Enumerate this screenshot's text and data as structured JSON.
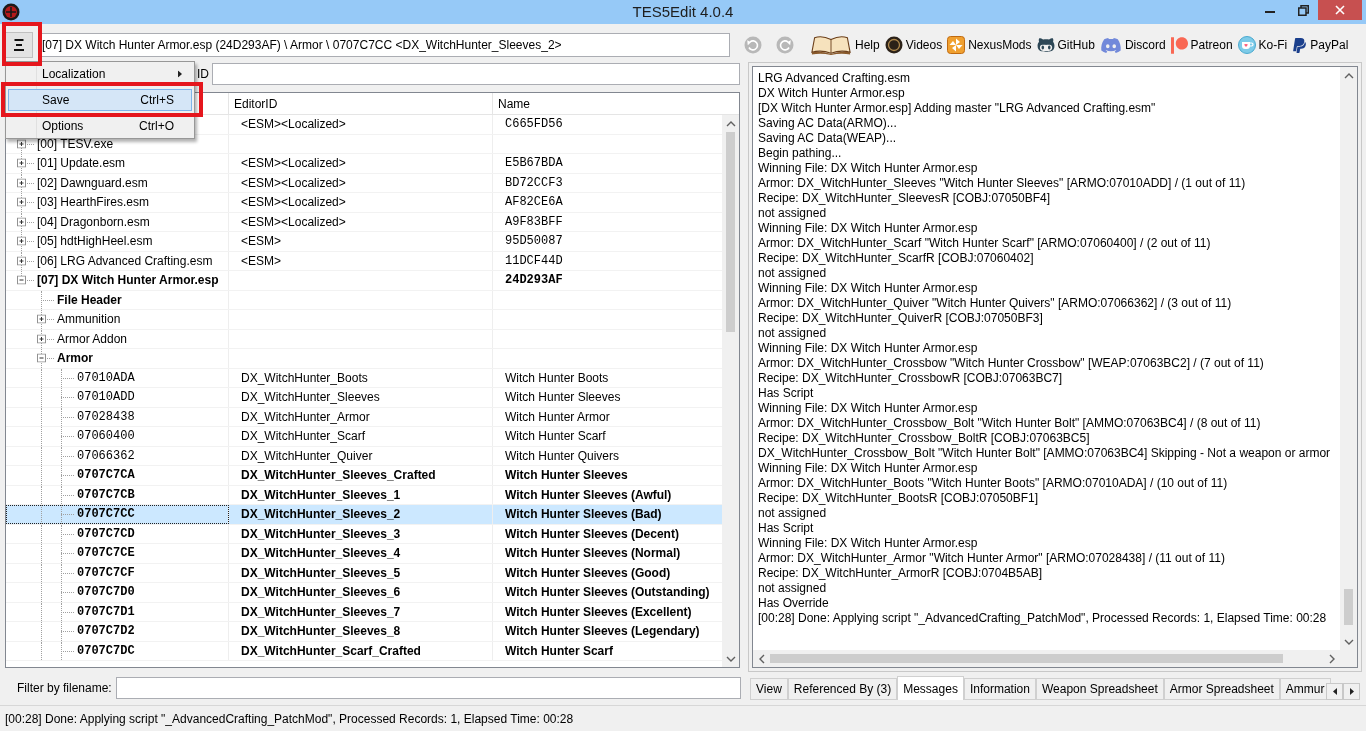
{
  "window": {
    "title": "TES5Edit 4.0.4"
  },
  "menu_button": {
    "highlighted": true
  },
  "path_field": {
    "value": "[07] DX Witch Hunter Armor.esp (24D293AF) \\ Armor \\ 0707C7CC <DX_WitchHunter_Sleeves_2>"
  },
  "navigation": [
    {
      "kind": "back",
      "disabled": true
    },
    {
      "kind": "forward",
      "disabled": true
    }
  ],
  "links": [
    {
      "kind": "book",
      "label": "Help"
    },
    {
      "kind": "disc",
      "label": "Videos"
    },
    {
      "kind": "nexus",
      "label": "NexusMods"
    },
    {
      "kind": "github",
      "label": "GitHub"
    },
    {
      "kind": "discord",
      "label": "Discord"
    },
    {
      "kind": "patreon",
      "label": "Patreon"
    },
    {
      "kind": "kofi",
      "label": "Ko-Fi"
    },
    {
      "kind": "paypal",
      "label": "PayPal"
    }
  ],
  "main_menu": {
    "items": [
      {
        "label": "Localization",
        "submenu": true,
        "selected": false,
        "highlighted": false
      },
      {
        "label": "Save",
        "shortcut": "Ctrl+S",
        "selected": true,
        "highlighted": true
      },
      {
        "label": "Options",
        "shortcut": "Ctrl+O",
        "selected": false,
        "highlighted": false
      }
    ]
  },
  "id_search": {
    "label": "ID"
  },
  "tree": {
    "column_headers": {
      "column_2": "EditorID",
      "column_3": "Name"
    },
    "rows": [
      {
        "kind": "file",
        "editor_id": "<ESM><Localized>",
        "name": "C665FD56",
        "bold": false,
        "selected": false
      },
      {
        "kind": "file",
        "label": "[00] TESV.exe",
        "expanded": false,
        "bold": false,
        "selected": false
      },
      {
        "kind": "file",
        "label": "[01] Update.esm",
        "editor_id": "<ESM><Localized>",
        "name": "E5B67BDA",
        "expanded": false,
        "bold": false,
        "selected": false
      },
      {
        "kind": "file",
        "label": "[02] Dawnguard.esm",
        "editor_id": "<ESM><Localized>",
        "name": "BD72CCF3",
        "expanded": false,
        "bold": false,
        "selected": false
      },
      {
        "kind": "file",
        "label": "[03] HearthFires.esm",
        "editor_id": "<ESM><Localized>",
        "name": "AF82CE6A",
        "expanded": false,
        "bold": false,
        "selected": false
      },
      {
        "kind": "file",
        "label": "[04] Dragonborn.esm",
        "editor_id": "<ESM><Localized>",
        "name": "A9F83BFF",
        "expanded": false,
        "bold": false,
        "selected": false
      },
      {
        "kind": "file",
        "label": "[05] hdtHighHeel.esm",
        "editor_id": "<ESM>",
        "name": "95D50087",
        "expanded": false,
        "bold": false,
        "selected": false
      },
      {
        "kind": "file",
        "label": "[06] LRG Advanced Crafting.esm",
        "editor_id": "<ESM>",
        "name": "11DCF44D",
        "expanded": false,
        "bold": false,
        "selected": false
      },
      {
        "kind": "file",
        "label": "[07] DX Witch Hunter Armor.esp",
        "name": "24D293AF",
        "expanded": true,
        "bold": true,
        "selected": false,
        "children": [
          {
            "kind": "group",
            "label": "File Header",
            "bold": true,
            "selected": false
          },
          {
            "kind": "group",
            "label": "Ammunition",
            "expanded": false,
            "bold": false,
            "selected": false
          },
          {
            "kind": "group",
            "label": "Armor Addon",
            "expanded": false,
            "bold": false,
            "selected": false
          },
          {
            "kind": "group",
            "label": "Armor",
            "expanded": true,
            "bold": true,
            "selected": false,
            "children": [
              {
                "kind": "record",
                "label": "07010ADA",
                "editor_id": "DX_WitchHunter_Boots",
                "name": "Witch Hunter Boots",
                "bold": false,
                "selected": false
              },
              {
                "kind": "record",
                "label": "07010ADD",
                "editor_id": "DX_WitchHunter_Sleeves",
                "name": "Witch Hunter Sleeves",
                "bold": false,
                "selected": false
              },
              {
                "kind": "record",
                "label": "07028438",
                "editor_id": "DX_WitchHunter_Armor",
                "name": "Witch Hunter Armor",
                "bold": false,
                "selected": false
              },
              {
                "kind": "record",
                "label": "07060400",
                "editor_id": "DX_WitchHunter_Scarf",
                "name": "Witch Hunter Scarf",
                "bold": false,
                "selected": false
              },
              {
                "kind": "record",
                "label": "07066362",
                "editor_id": "DX_WitchHunter_Quiver",
                "name": "Witch Hunter Quivers",
                "bold": false,
                "selected": false
              },
              {
                "kind": "record",
                "label": "0707C7CA",
                "editor_id": "DX_WitchHunter_Sleeves_Crafted",
                "name": "Witch Hunter Sleeves",
                "bold": true,
                "selected": false
              },
              {
                "kind": "record",
                "label": "0707C7CB",
                "editor_id": "DX_WitchHunter_Sleeves_1",
                "name": "Witch Hunter Sleeves (Awful)",
                "bold": true,
                "selected": false
              },
              {
                "kind": "record",
                "label": "0707C7CC",
                "editor_id": "DX_WitchHunter_Sleeves_2",
                "name": "Witch Hunter Sleeves (Bad)",
                "bold": true,
                "selected": true
              },
              {
                "kind": "record",
                "label": "0707C7CD",
                "editor_id": "DX_WitchHunter_Sleeves_3",
                "name": "Witch Hunter Sleeves (Decent)",
                "bold": true,
                "selected": false
              },
              {
                "kind": "record",
                "label": "0707C7CE",
                "editor_id": "DX_WitchHunter_Sleeves_4",
                "name": "Witch Hunter Sleeves (Normal)",
                "bold": true,
                "selected": false
              },
              {
                "kind": "record",
                "label": "0707C7CF",
                "editor_id": "DX_WitchHunter_Sleeves_5",
                "name": "Witch Hunter Sleeves (Good)",
                "bold": true,
                "selected": false
              },
              {
                "kind": "record",
                "label": "0707C7D0",
                "editor_id": "DX_WitchHunter_Sleeves_6",
                "name": "Witch Hunter Sleeves (Outstanding)",
                "bold": true,
                "selected": false
              },
              {
                "kind": "record",
                "label": "0707C7D1",
                "editor_id": "DX_WitchHunter_Sleeves_7",
                "name": "Witch Hunter Sleeves (Excellent)",
                "bold": true,
                "selected": false
              },
              {
                "kind": "record",
                "label": "0707C7D2",
                "editor_id": "DX_WitchHunter_Sleeves_8",
                "name": "Witch Hunter Sleeves (Legendary)",
                "bold": true,
                "selected": false
              },
              {
                "kind": "record",
                "label": "0707C7DC",
                "editor_id": "DX_WitchHunter_Scarf_Crafted",
                "name": "Witch Hunter Scarf",
                "bold": true,
                "selected": false
              }
            ]
          }
        ]
      }
    ]
  },
  "filter": {
    "label": "Filter by filename:"
  },
  "messages": [
    "LRG Advanced Crafting.esm",
    "DX Witch Hunter Armor.esp",
    "[DX Witch Hunter Armor.esp] Adding master \"LRG Advanced Crafting.esm\"",
    "Saving AC Data(ARMO)...",
    "Saving AC Data(WEAP)...",
    "Begin pathing...",
    "Winning File: DX Witch Hunter Armor.esp",
    "Armor: DX_WitchHunter_Sleeves \"Witch Hunter Sleeves\" [ARMO:07010ADD] / (1 out of 11)",
    "Recipe: DX_WitchHunter_SleevesR [COBJ:07050BF4]",
    "not assigned",
    "Winning File: DX Witch Hunter Armor.esp",
    "Armor: DX_WitchHunter_Scarf \"Witch Hunter Scarf\" [ARMO:07060400] / (2 out of 11)",
    "Recipe: DX_WitchHunter_ScarfR [COBJ:07060402]",
    "not assigned",
    "Winning File: DX Witch Hunter Armor.esp",
    "Armor: DX_WitchHunter_Quiver \"Witch Hunter Quivers\" [ARMO:07066362] / (3 out of 11)",
    "Recipe: DX_WitchHunter_QuiverR [COBJ:07050BF3]",
    "not assigned",
    "Winning File: DX Witch Hunter Armor.esp",
    "Armor: DX_WitchHunter_Crossbow \"Witch Hunter Crossbow\" [WEAP:07063BC2] / (7 out of 11)",
    "Recipe: DX_WitchHunter_CrossbowR [COBJ:07063BC7]",
    "Has Script",
    "Winning File: DX Witch Hunter Armor.esp",
    "Armor: DX_WitchHunter_Crossbow_Bolt \"Witch Hunter Bolt\" [AMMO:07063BC4] / (8 out of 11)",
    "Recipe: DX_WitchHunter_Crossbow_BoltR [COBJ:07063BC5]",
    "DX_WitchHunter_Crossbow_Bolt \"Witch Hunter Bolt\" [AMMO:07063BC4] Skipping - Not a weapon or armor",
    "Winning File: DX Witch Hunter Armor.esp",
    "Armor: DX_WitchHunter_Boots \"Witch Hunter Boots\" [ARMO:07010ADA] / (10 out of 11)",
    "Recipe: DX_WitchHunter_BootsR [COBJ:07050BF1]",
    "not assigned",
    "Has Script",
    "Winning File: DX Witch Hunter Armor.esp",
    "Armor: DX_WitchHunter_Armor \"Witch Hunter Armor\" [ARMO:07028438] / (11 out of 11)",
    "Recipe: DX_WitchHunter_ArmorR [COBJ:0704B5AB]",
    "not assigned",
    "Has Override",
    "[00:28] Done: Applying script \"_AdvancedCrafting_PatchMod\", Processed Records: 1, Elapsed Time: 00:28"
  ],
  "bottom_tabs": [
    {
      "label": "View",
      "selected": false
    },
    {
      "label": "Referenced By (3)",
      "selected": false
    },
    {
      "label": "Messages",
      "selected": true
    },
    {
      "label": "Information",
      "selected": false
    },
    {
      "label": "Weapon Spreadsheet",
      "selected": false
    },
    {
      "label": "Armor Spreadsheet",
      "selected": false
    },
    {
      "label": "Ammur",
      "selected": false
    }
  ],
  "status_bar": "[00:28] Done: Applying script \"_AdvancedCrafting_PatchMod\", Processed Records: 1, Elapsed Time: 00:28"
}
